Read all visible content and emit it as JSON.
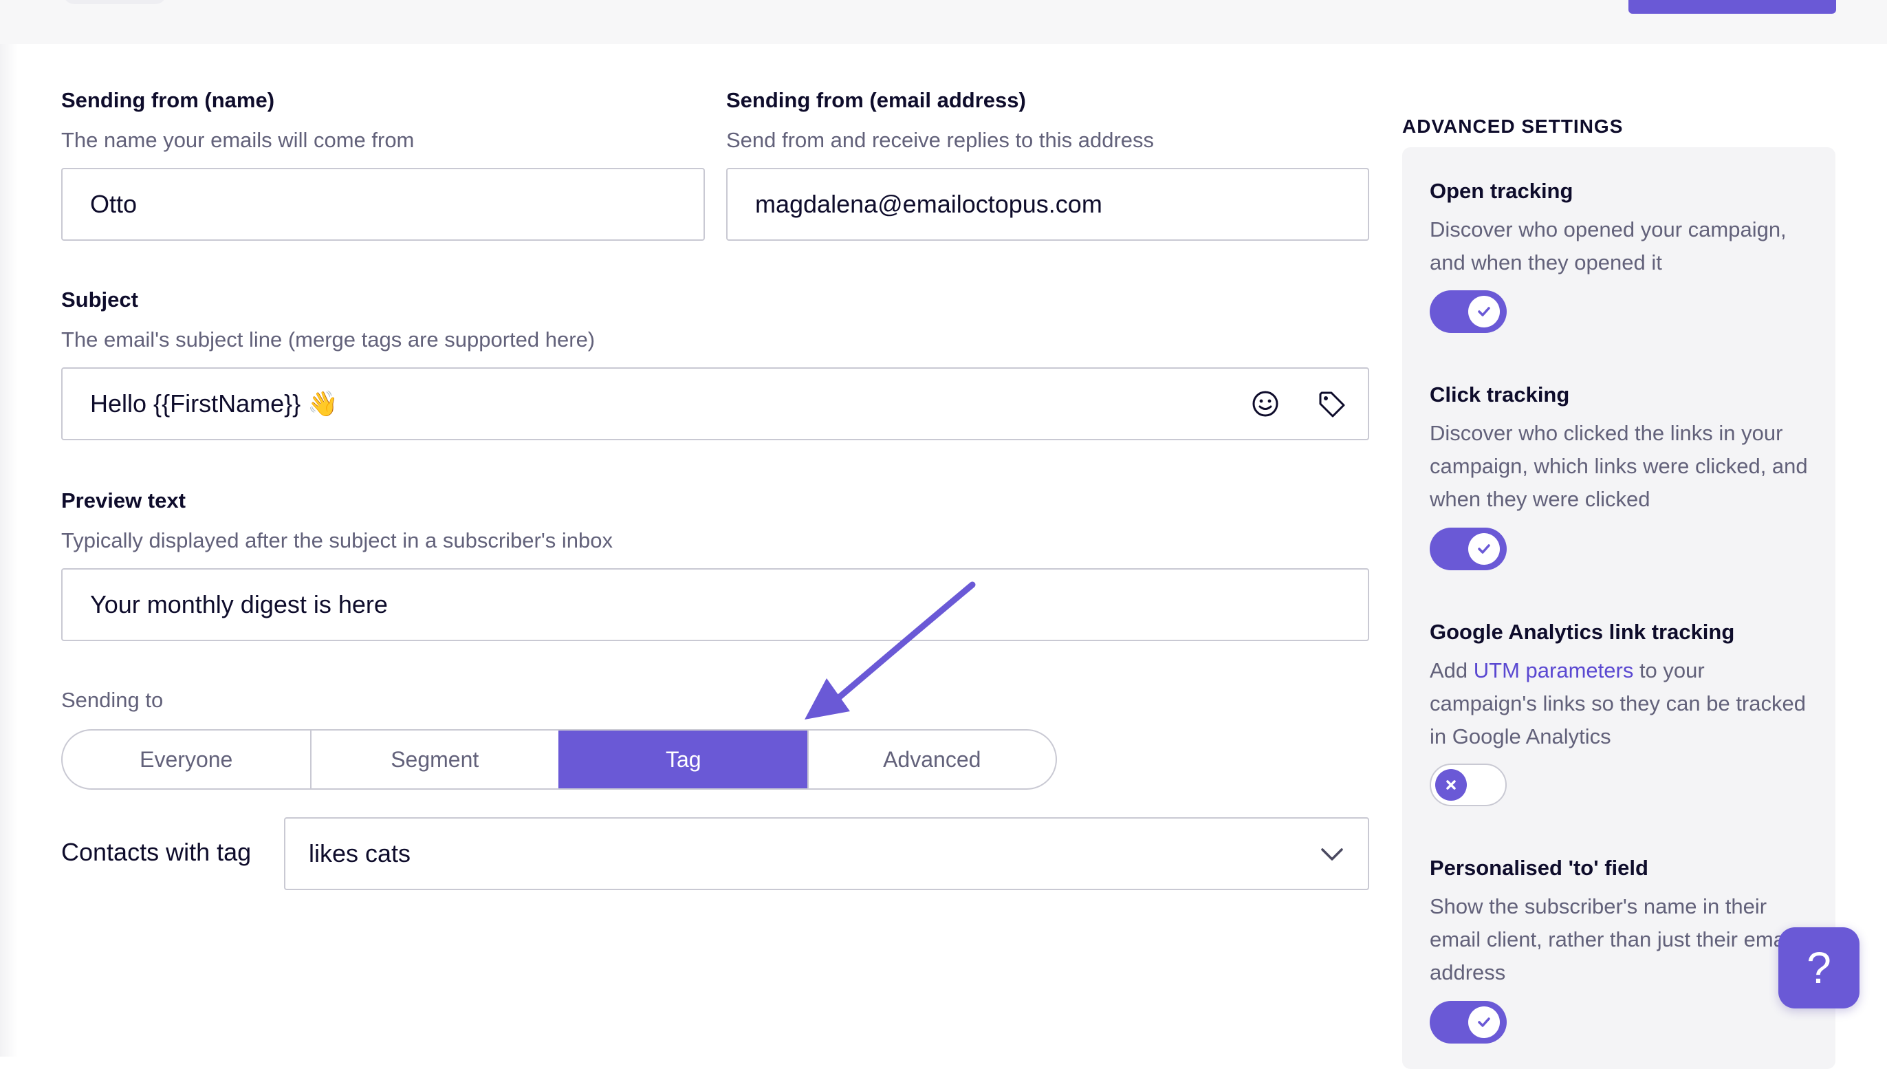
{
  "form": {
    "from_name": {
      "title": "Sending from (name)",
      "help": "The name your emails will come from",
      "value": "Otto"
    },
    "from_email": {
      "title": "Sending from (email address)",
      "help": "Send from and receive replies to this address",
      "value": "magdalena@emailoctopus.com"
    },
    "subject": {
      "title": "Subject",
      "help": "The email's subject line (merge tags are supported here)",
      "value": "Hello {{FirstName}} 👋",
      "icons": [
        "emoji-icon",
        "tag-icon"
      ]
    },
    "preview": {
      "title": "Preview text",
      "help": "Typically displayed after the subject in a subscriber's inbox",
      "value": "Your monthly digest is here"
    },
    "sending_to": {
      "label": "Sending to",
      "options": [
        "Everyone",
        "Segment",
        "Tag",
        "Advanced"
      ],
      "selected": "Tag"
    },
    "tag": {
      "label": "Contacts with tag",
      "value": "likes cats"
    }
  },
  "advanced": {
    "heading": "ADVANCED SETTINGS",
    "options": [
      {
        "title": "Open tracking",
        "desc": "Discover who opened your campaign, and when they opened it",
        "enabled": true
      },
      {
        "title": "Click tracking",
        "desc": "Discover who clicked the links in your campaign, which links were clicked, and when they were clicked",
        "enabled": true
      },
      {
        "title": "Google Analytics link tracking",
        "desc_prefix": "Add ",
        "desc_link": "UTM parameters",
        "desc_suffix": " to your campaign's links so they can be tracked in Google Analytics",
        "enabled": false
      },
      {
        "title": "Personalised 'to' field",
        "desc": "Show the subscriber's name in their email client, rather than just their email address",
        "enabled": true
      }
    ]
  },
  "help_button": {
    "label": "?"
  },
  "colors": {
    "accent": "#6a59d6",
    "text": "#0e0c2b",
    "muted": "#62617a",
    "border": "#c9c9d3",
    "panel": "#f4f4f6"
  }
}
